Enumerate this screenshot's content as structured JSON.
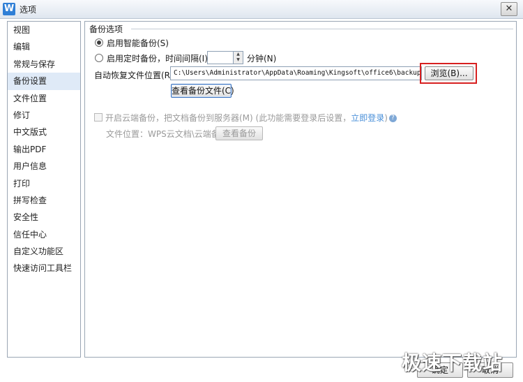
{
  "window": {
    "title": "选项",
    "close_glyph": "✕",
    "app_icon_letter": "W"
  },
  "sidebar": {
    "items": [
      {
        "label": "视图"
      },
      {
        "label": "编辑"
      },
      {
        "label": "常规与保存"
      },
      {
        "label": "备份设置",
        "selected": true
      },
      {
        "label": "文件位置"
      },
      {
        "label": "修订"
      },
      {
        "label": "中文版式"
      },
      {
        "label": "输出PDF"
      },
      {
        "label": "用户信息"
      },
      {
        "label": "打印"
      },
      {
        "label": "拼写检查"
      },
      {
        "label": "安全性"
      },
      {
        "label": "信任中心"
      },
      {
        "label": "自定义功能区"
      },
      {
        "label": "快速访问工具栏"
      }
    ]
  },
  "backup": {
    "section_title": "备份选项",
    "smart_backup_label": "启用智能备份(S)",
    "timed_backup_label": "启用定时备份，时间间隔(I):",
    "minutes_label": "分钟(N)",
    "path_label": "自动恢复文件位置(R):",
    "path_value": "C:\\Users\\Administrator\\AppData\\Roaming\\Kingsoft\\office6\\backup",
    "browse_label": "浏览(B)...",
    "view_files_label": "查看备份文件(C)"
  },
  "cloud": {
    "enable_label": "开启云端备份，把文档备份到服务器(M) (此功能需要登录后设置，",
    "login_link": "立即登录",
    "login_suffix": ")",
    "location_label": "文件位置：WPS云文档\\云端备份",
    "view_backup_label": "查看备份"
  },
  "footer": {
    "ok_label": "确定",
    "cancel_label": "取消"
  },
  "watermark": "极速下载站"
}
